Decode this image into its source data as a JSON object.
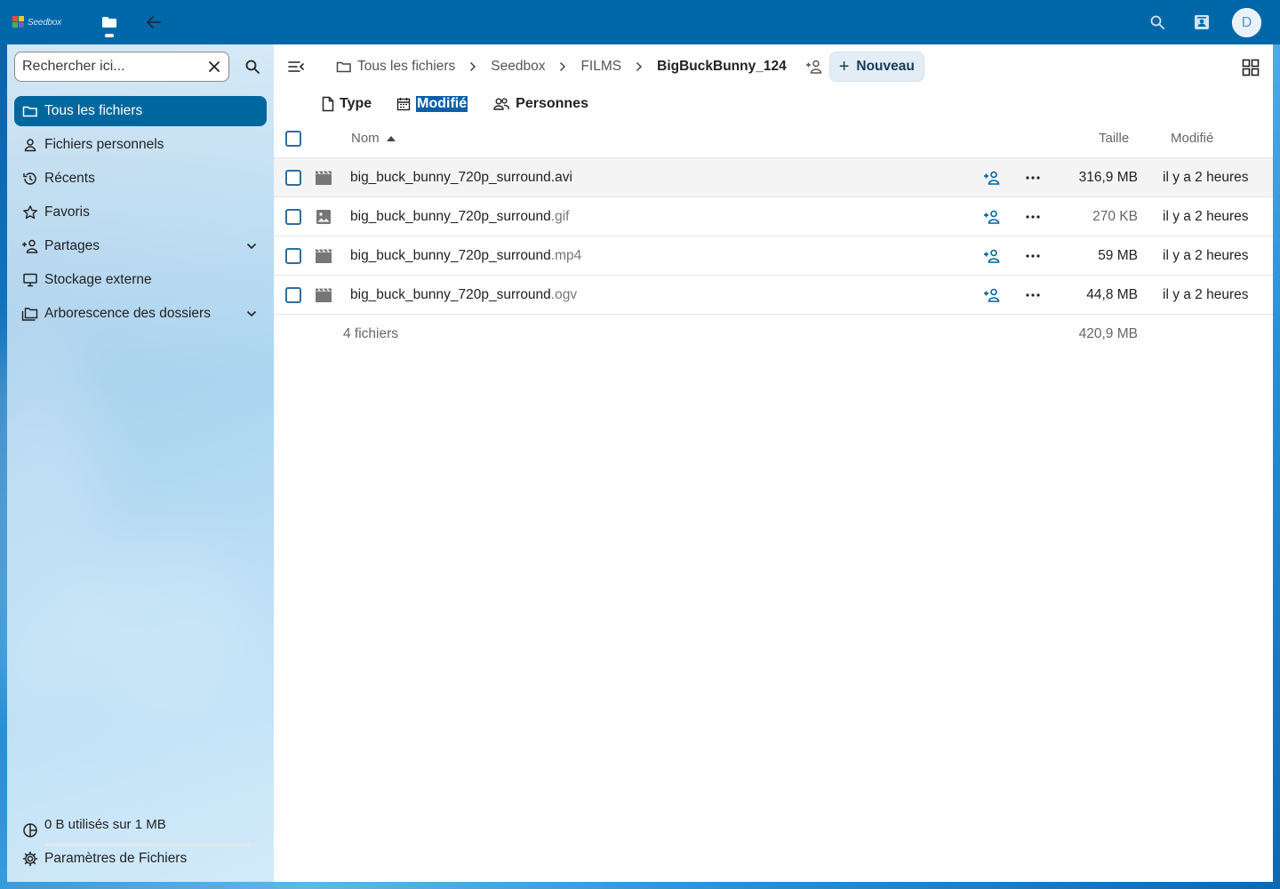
{
  "app": {
    "logo_text": "Seedbox",
    "avatar_letter": "D"
  },
  "sidebar": {
    "search_placeholder": "Rechercher ici...",
    "items": [
      {
        "label": "Tous les fichiers",
        "icon": "folder-icon",
        "active": true
      },
      {
        "label": "Fichiers personnels",
        "icon": "person-icon"
      },
      {
        "label": "Récents",
        "icon": "history-icon"
      },
      {
        "label": "Favoris",
        "icon": "star-icon"
      },
      {
        "label": "Partages",
        "icon": "share-icon",
        "expandable": true
      },
      {
        "label": "Stockage externe",
        "icon": "external-storage-icon"
      },
      {
        "label": "Arborescence des dossiers",
        "icon": "folder-tree-icon",
        "expandable": true
      }
    ],
    "quota_text": "0 B utilisés sur 1 MB",
    "quota_fraction": 0,
    "settings_label": "Paramètres de Fichiers"
  },
  "breadcrumb": {
    "items": [
      "Tous les fichiers",
      "Seedbox",
      "FILMS",
      "BigBuckBunny_124"
    ],
    "new_button_label": "Nouveau"
  },
  "filters": {
    "type_label": "Type",
    "modified_label": "Modifié",
    "people_label": "Personnes"
  },
  "table": {
    "col_name": "Nom",
    "col_size": "Taille",
    "col_modified": "Modifié",
    "rows": [
      {
        "base": "big_buck_bunny_720p_surround",
        "ext": ".avi",
        "size": "316,9 MB",
        "modified": "il y a 2 heures",
        "icon": "video-icon"
      },
      {
        "base": "big_buck_bunny_720p_surround",
        "ext": ".gif",
        "size": "270 KB",
        "modified": "il y a 2 heures",
        "icon": "image-icon"
      },
      {
        "base": "big_buck_bunny_720p_surround",
        "ext": ".mp4",
        "size": "59 MB",
        "modified": "il y a 2 heures",
        "icon": "video-icon"
      },
      {
        "base": "big_buck_bunny_720p_surround",
        "ext": ".ogv",
        "size": "44,8 MB",
        "modified": "il y a 2 heures",
        "icon": "video-icon"
      }
    ],
    "summary_count": "4 fichiers",
    "summary_size": "420,9 MB"
  },
  "colors": {
    "header": "#0068a8",
    "accent": "#00679e"
  }
}
